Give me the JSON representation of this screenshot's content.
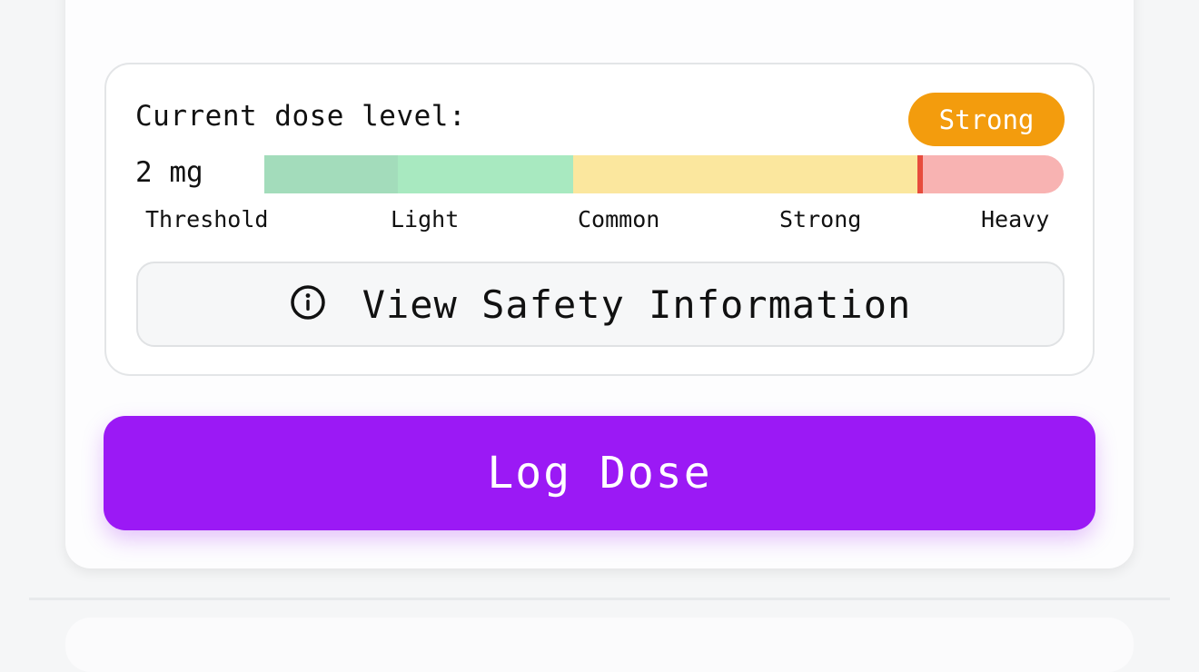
{
  "dose": {
    "label": "Current dose level:",
    "level_badge": "Strong",
    "badge_color": "#f39c0d",
    "amount": "2 mg",
    "marker_position_fraction": 0.82,
    "marker_color": "#e74c3c",
    "segments": [
      {
        "name": "Threshold",
        "color": "#a3dcbb",
        "fraction": 0.167
      },
      {
        "name": "Light",
        "color": "#a8e9c0",
        "fraction": 0.219
      },
      {
        "name": "Common",
        "color": "#fbe79e",
        "fraction": 0.433
      },
      {
        "name": "Heavy",
        "color": "#f8b3b2",
        "fraction": 0.181
      }
    ],
    "ticks": [
      "Threshold",
      "Light",
      "Common",
      "Strong",
      "Heavy"
    ]
  },
  "safety": {
    "label": "View Safety Information",
    "icon": "info-icon"
  },
  "actions": {
    "log_dose_label": "Log Dose",
    "log_dose_color": "#9b19f5"
  }
}
